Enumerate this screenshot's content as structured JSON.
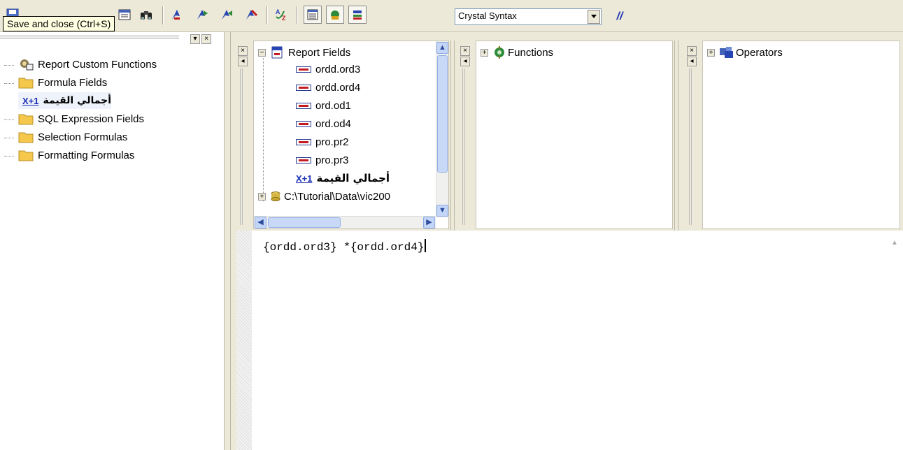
{
  "toolbar": {
    "tooltip": "Save and close (Ctrl+S)",
    "syntax_select": "Crystal Syntax",
    "comment_label": "//",
    "icons": [
      "save-close-icon",
      "binoculars-icon",
      "bookmark-icon",
      "next-bookmark-icon",
      "previous-bookmark-icon",
      "clear-bookmarks-icon",
      "sort-icon",
      "field-tree-icon",
      "function-tree-icon",
      "operator-tree-icon",
      "comment-icon"
    ]
  },
  "workshop_tree": {
    "items": [
      {
        "label": "Report Custom Functions",
        "icon": "custom-function-icon"
      },
      {
        "label": "Formula Fields",
        "icon": "folder-icon"
      },
      {
        "label": "أجمالي القيمة",
        "icon": "formula-icon"
      },
      {
        "label": "SQL Expression Fields",
        "icon": "folder-icon"
      },
      {
        "label": "Selection Formulas",
        "icon": "folder-icon"
      },
      {
        "label": "Formatting Formulas",
        "icon": "folder-icon"
      }
    ]
  },
  "fields_panel": {
    "root": "Report Fields",
    "items": [
      "ordd.ord3",
      "ordd.ord4",
      "ord.od1",
      "ord.od4",
      "pro.pr2",
      "pro.pr3"
    ],
    "formula_item": "أجمالي القيمة",
    "formula_prefix": "X+1",
    "database": "C:\\Tutorial\\Data\\vic200"
  },
  "functions_panel": {
    "root": "Functions"
  },
  "operators_panel": {
    "root": "Operators"
  },
  "editor": {
    "text": "{ordd.ord3} *{ordd.ord4}"
  },
  "colors": {
    "accent": "#316ac5",
    "formula_blue": "#1a2fb5",
    "folder": "#f5c84b"
  }
}
